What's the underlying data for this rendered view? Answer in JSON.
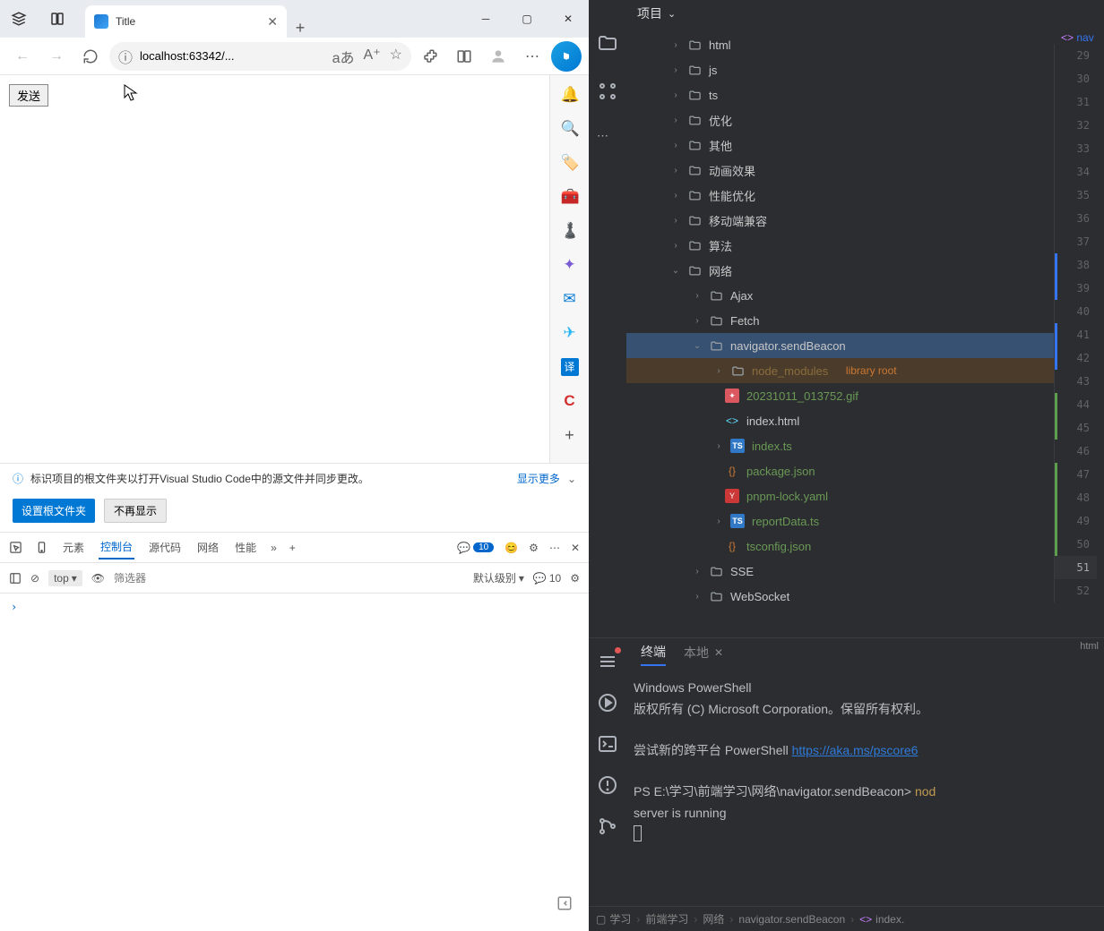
{
  "browser": {
    "tab_title": "Title",
    "address": "localhost:63342/...",
    "addr_lang": "aあ",
    "page_button": "发送",
    "notice_text": "标识项目的根文件夹以打开Visual Studio Code中的源文件并同步更改。",
    "notice_link": "显示更多",
    "btn_set_root": "设置根文件夹",
    "btn_hide": "不再显示",
    "devtools": {
      "tabs": {
        "elements": "元素",
        "console": "控制台",
        "sources": "源代码",
        "network": "网络",
        "performance": "性能"
      },
      "badge_count": "10",
      "scope": "top",
      "filter_placeholder": "筛选器",
      "level": "默认级别",
      "msg_count": "10"
    }
  },
  "ide": {
    "project_label": "项目",
    "editor_tab": "nav",
    "lang_badge": "html",
    "tree": {
      "html": "html",
      "js": "js",
      "ts": "ts",
      "opt": "优化",
      "other": "其他",
      "anim": "动画效果",
      "perf": "性能优化",
      "mobile": "移动端兼容",
      "algo": "算法",
      "net": "网络",
      "ajax": "Ajax",
      "fetch": "Fetch",
      "beacon": "navigator.sendBeacon",
      "node_modules": "node_modules",
      "lib_root": "library root",
      "gif": "20231011_013752.gif",
      "index_html": "index.html",
      "index_ts": "index.ts",
      "package": "package.json",
      "lock": "pnpm-lock.yaml",
      "report": "reportData.ts",
      "tsconfig": "tsconfig.json",
      "sse": "SSE",
      "ws": "WebSocket"
    },
    "line_numbers": [
      "29",
      "30",
      "31",
      "32",
      "33",
      "34",
      "35",
      "36",
      "37",
      "38",
      "39",
      "40",
      "41",
      "42",
      "43",
      "44",
      "45",
      "46",
      "47",
      "48",
      "49",
      "50",
      "51",
      "52"
    ],
    "terminal": {
      "tab_active": "终端",
      "tab_local": "本地",
      "line1": "Windows PowerShell",
      "line2": "版权所有 (C) Microsoft Corporation。保留所有权利。",
      "line3": "尝试新的跨平台 PowerShell ",
      "link": "https://aka.ms/pscore6",
      "prompt_path": "PS E:\\学习\\前端学习\\网络\\navigator.sendBeacon> ",
      "cmd": "nod",
      "running": "server is running"
    },
    "breadcrumb": {
      "c1": "学习",
      "c2": "前端学习",
      "c3": "网络",
      "c4": "navigator.sendBeacon",
      "c5": "index."
    }
  }
}
